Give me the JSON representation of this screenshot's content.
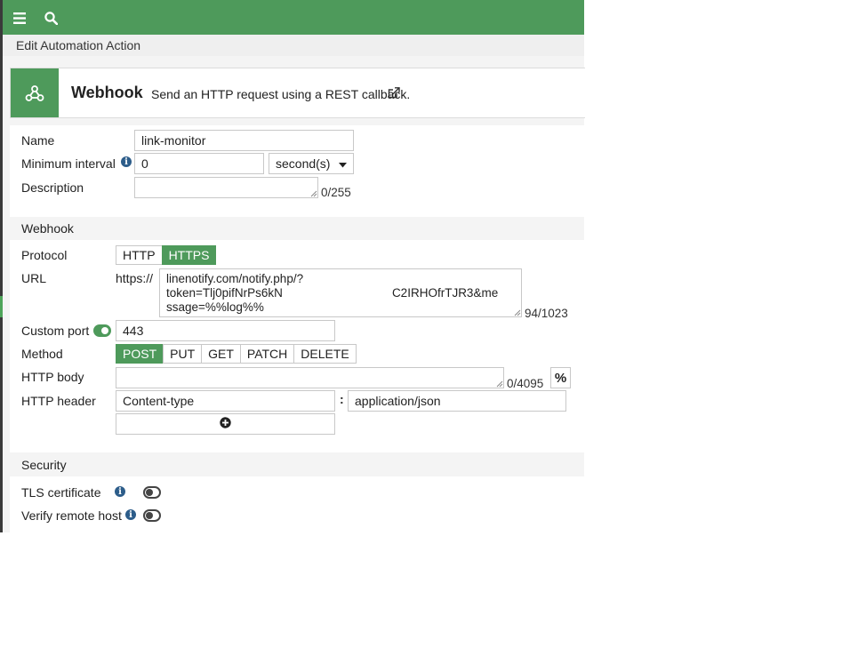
{
  "subheader": {
    "title": "Edit Automation Action"
  },
  "action_card": {
    "title": "Webhook",
    "description": "Send an HTTP request using a REST callback."
  },
  "form": {
    "name": {
      "label": "Name",
      "value": "link-monitor"
    },
    "min_interval": {
      "label": "Minimum interval",
      "value": "0",
      "unit": "second(s)"
    },
    "description": {
      "label": "Description",
      "value": "",
      "counter": "0/255"
    }
  },
  "webhook_section": {
    "heading": "Webhook",
    "protocol": {
      "label": "Protocol",
      "options": [
        "HTTP",
        "HTTPS"
      ],
      "selected": "HTTPS"
    },
    "url": {
      "label": "URL",
      "prefix": "https://",
      "lines": [
        "linenotify.com/notify.php/?",
        "token=Tlj0pifNrPs6kN",
        "ssage=%%log%%"
      ],
      "line2_tail": "C2IRHOfrTJR3&me",
      "counter": "94/1023"
    },
    "custom_port": {
      "label": "Custom port",
      "enabled": true,
      "value": "443"
    },
    "method": {
      "label": "Method",
      "options": [
        "POST",
        "PUT",
        "GET",
        "PATCH",
        "DELETE"
      ],
      "selected": "POST"
    },
    "http_body": {
      "label": "HTTP body",
      "value": "",
      "counter": "0/4095",
      "var_button": "%"
    },
    "http_header": {
      "label": "HTTP header",
      "key": "Content-type",
      "separator": ":",
      "value": "application/json"
    }
  },
  "security_section": {
    "heading": "Security",
    "tls_certificate": {
      "label": "TLS certificate",
      "enabled": false
    },
    "verify_remote_host": {
      "label": "Verify remote host",
      "enabled": false
    }
  },
  "colors": {
    "brand_green": "#4e9a5b",
    "info_blue": "#2d5d8a"
  }
}
